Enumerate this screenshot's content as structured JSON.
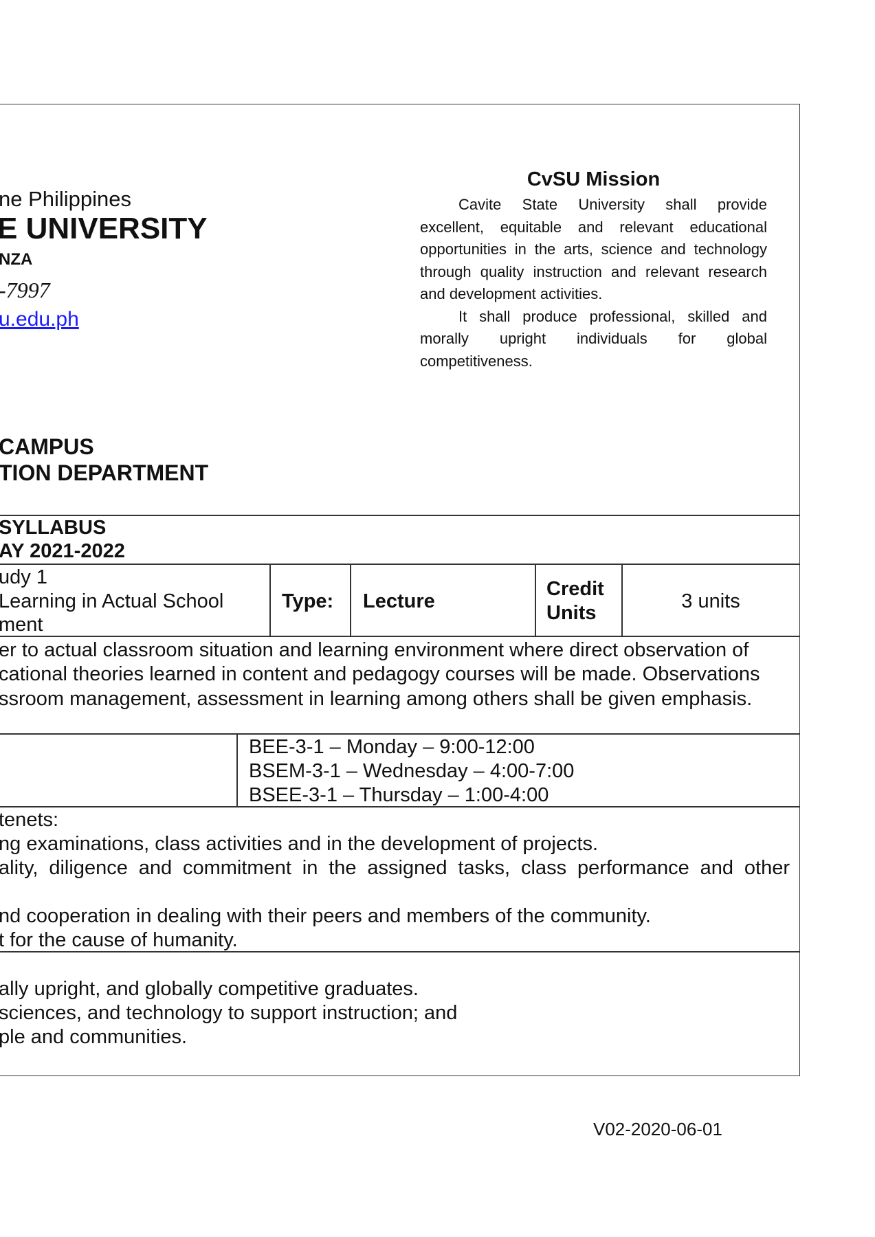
{
  "header": {
    "country": "ne Philippines",
    "university": "E UNIVERSITY",
    "campus_town": "NZA",
    "phone": "-7997",
    "email": "u.edu.ph",
    "campus": "CAMPUS",
    "department": "TION DEPARTMENT"
  },
  "mission": {
    "title": "CvSU Mission",
    "paragraph1": "Cavite State University shall provide excellent, equitable and relevant educational opportunities in the arts, science and technology through quality instruction and relevant research and development activities.",
    "paragraph2": "It shall produce professional, skilled and morally upright individuals for global competitiveness."
  },
  "syllabus": {
    "title": "SYLLABUS",
    "year": "AY 2021-2022"
  },
  "course": {
    "title_lines": [
      "udy 1",
      "Learning in Actual School",
      "ment"
    ],
    "type_label": "Type:",
    "type_value": "Lecture",
    "credit_label_1": "Credit",
    "credit_label_2": "Units",
    "credit_value": "3 units"
  },
  "description": {
    "lines": [
      "er to actual classroom situation and learning environment where direct observation of",
      "cational theories learned in content and pedagogy courses will be made. Observations",
      "ssroom management, assessment in learning among others shall be given emphasis."
    ]
  },
  "schedule": {
    "entries": [
      "BEE-3-1 – Monday – 9:00-12:00",
      "BSEM-3-1 – Wednesday – 4:00-7:00",
      "BSEE-3-1 – Thursday – 1:00-4:00"
    ]
  },
  "tenets": {
    "lines": [
      "tenets:",
      "ng examinations, class activities and in the development of projects.",
      "ality, diligence and commitment in the assigned tasks, class performance and other",
      "nd cooperation in dealing with their peers and members of the community.",
      "t for the cause of humanity."
    ]
  },
  "goals": {
    "lines": [
      "ally upright, and globally competitive graduates.",
      "sciences, and technology to support instruction; and",
      "ple and communities."
    ]
  },
  "footer": {
    "version": "V02-2020-06-01"
  }
}
